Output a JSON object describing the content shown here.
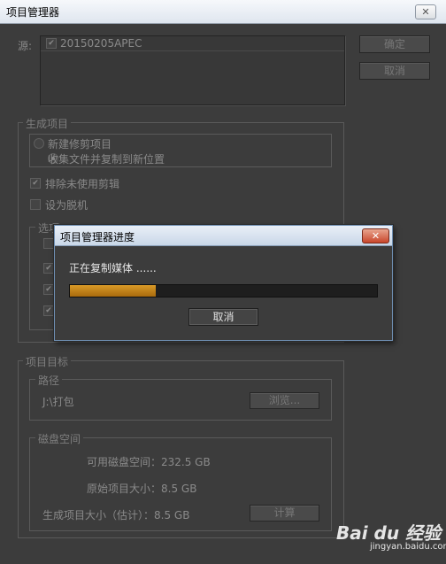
{
  "window": {
    "title": "项目管理器",
    "close_glyph": "✕"
  },
  "source": {
    "label": "源:",
    "items": [
      {
        "name": "20150205APEC",
        "checked": true
      }
    ]
  },
  "buttons": {
    "ok": "确定",
    "cancel": "取消"
  },
  "generate": {
    "legend": "生成项目",
    "options": [
      {
        "label": "新建修剪项目",
        "selected": false
      },
      {
        "label": "收集文件并复制到新位置",
        "selected": true
      }
    ],
    "exclude_unused": {
      "label": "排除未使用剪辑",
      "checked": true
    },
    "set_offline": {
      "label": "设为脱机",
      "checked": false
    },
    "options_legend": "选项"
  },
  "target": {
    "legend": "项目目标",
    "path": {
      "legend": "路径",
      "value": "J:\\打包",
      "browse": "浏览..."
    },
    "disk": {
      "legend": "磁盘空间",
      "available": "可用磁盘空间：232.5 GB",
      "original": "原始项目大小：8.5 GB",
      "estimated": "生成项目大小（估计）：8.5 GB",
      "calc": "计算"
    }
  },
  "progress_dialog": {
    "title": "项目管理器进度",
    "close_glyph": "✕",
    "status": "正在复制媒体 ......",
    "progress": 0.28,
    "cancel": "取消"
  },
  "watermark": {
    "brand": "Bai du 经验",
    "url": "jingyan.baidu.com"
  },
  "colors": {
    "accent": "#c98513",
    "background": "#3c3c3c"
  }
}
